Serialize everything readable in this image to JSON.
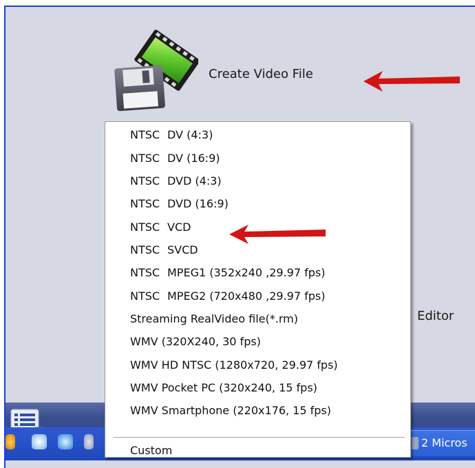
{
  "panel": {
    "create_video_label": "Create Video File",
    "editor_label": "Editor"
  },
  "menu": {
    "items": [
      {
        "standard": "NTSC",
        "format": "DV (4:3)"
      },
      {
        "standard": "NTSC",
        "format": "DV (16:9)"
      },
      {
        "standard": "NTSC",
        "format": "DVD (4:3)"
      },
      {
        "standard": "NTSC",
        "format": "DVD (16:9)"
      },
      {
        "standard": "NTSC",
        "format": "VCD"
      },
      {
        "standard": "NTSC",
        "format": "SVCD"
      },
      {
        "standard": "NTSC",
        "format": "MPEG1 (352x240 ,29.97 fps)"
      },
      {
        "standard": "NTSC",
        "format": "MPEG2 (720x480 ,29.97 fps)"
      },
      {
        "standard": "",
        "format": "Streaming RealVideo file(*.rm)"
      },
      {
        "standard": "",
        "format": "WMV (320X240, 30 fps)"
      },
      {
        "standard": "",
        "format": "WMV HD NTSC (1280x720, 29.97 fps)"
      },
      {
        "standard": "",
        "format": "WMV Pocket PC (320x240, 15 fps)"
      },
      {
        "standard": "",
        "format": "WMV Smartphone (220x176, 15 fps)"
      }
    ],
    "custom_label": "Custom"
  },
  "taskbar": {
    "task_button_label": "2 Micros"
  },
  "colors": {
    "arrow": "#d21414",
    "taskbar_blue": "#2854c9",
    "panel_bg": "#d6d8e3"
  }
}
